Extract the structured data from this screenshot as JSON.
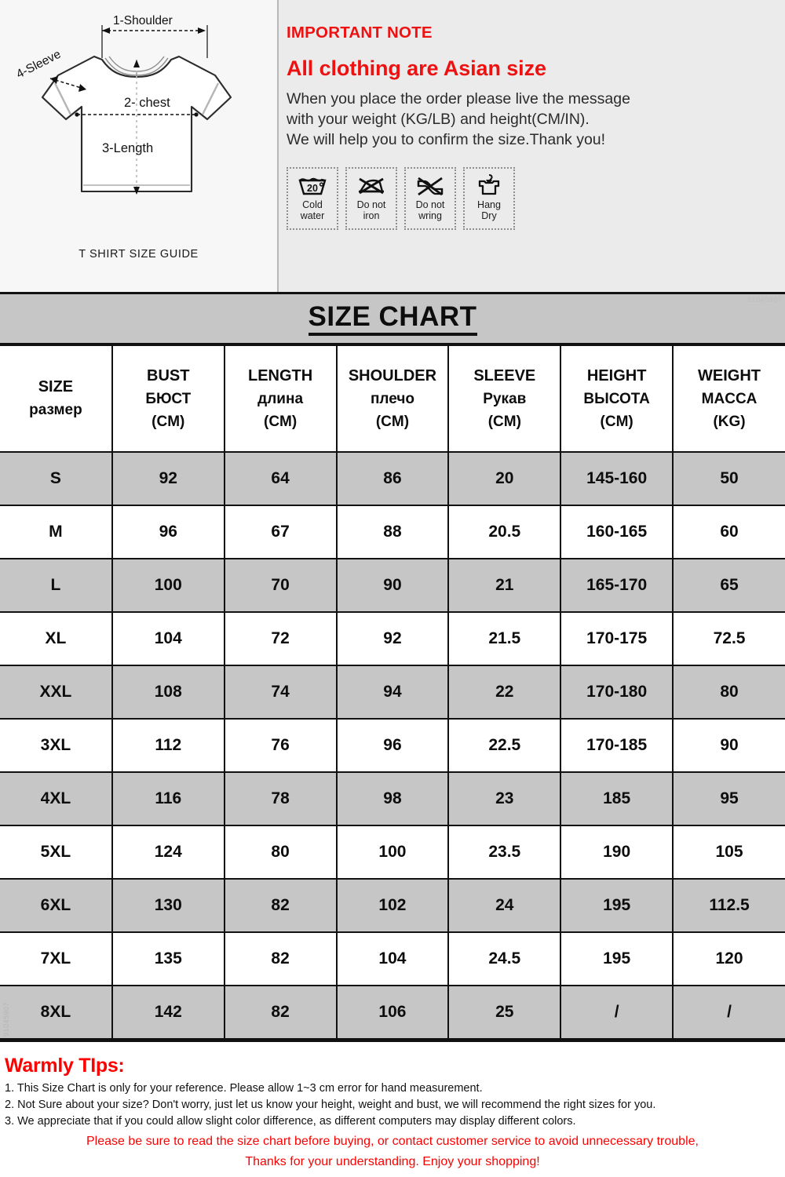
{
  "diagram": {
    "caption": "T SHIRT SIZE GUIDE",
    "labels": {
      "shoulder": "1-Shoulder",
      "sleeve": "4-Sleeve",
      "chest": "2- chest",
      "length": "3-Length"
    }
  },
  "note": {
    "title": "IMPORTANT NOTE",
    "headline": "All clothing are Asian size",
    "line1": "When you place the order please live the message",
    "line2": "with your weight (KG/LB) and height(CM/IN).",
    "line3": "We will help you to confirm the size.Thank you!"
  },
  "care_symbols": [
    {
      "icon": "cold-water-icon",
      "temp": "20",
      "label_line1": "Cold",
      "label_line2": "water"
    },
    {
      "icon": "do-not-iron-icon",
      "label_line1": "Do not",
      "label_line2": "iron"
    },
    {
      "icon": "do-not-wring-icon",
      "label_line1": "Do not",
      "label_line2": "wring"
    },
    {
      "icon": "hang-dry-icon",
      "label_line1": "Hang",
      "label_line2": "Dry"
    }
  ],
  "table": {
    "title": "SIZE CHART",
    "watermark": "91045907",
    "watermark_side": "91045907",
    "headers": [
      {
        "en": "SIZE",
        "ru": "размер",
        "unit": ""
      },
      {
        "en": "BUST",
        "ru": "БЮСТ",
        "unit": "(CM)"
      },
      {
        "en": "LENGTH",
        "ru": "длина",
        "unit": "(CM)"
      },
      {
        "en": "SHOULDER",
        "ru": "плечо",
        "unit": "(CM)"
      },
      {
        "en": "SLEEVE",
        "ru": "Рукав",
        "unit": "(CM)"
      },
      {
        "en": "HEIGHT",
        "ru": "ВЫСОТА",
        "unit": "(CM)"
      },
      {
        "en": "WEIGHT",
        "ru": "MACCA",
        "unit": "(KG)"
      }
    ],
    "rows": [
      {
        "size": "S",
        "bust": "92",
        "length": "64",
        "shoulder": "86",
        "sleeve": "20",
        "height": "145-160",
        "weight": "50"
      },
      {
        "size": "M",
        "bust": "96",
        "length": "67",
        "shoulder": "88",
        "sleeve": "20.5",
        "height": "160-165",
        "weight": "60"
      },
      {
        "size": "L",
        "bust": "100",
        "length": "70",
        "shoulder": "90",
        "sleeve": "21",
        "height": "165-170",
        "weight": "65"
      },
      {
        "size": "XL",
        "bust": "104",
        "length": "72",
        "shoulder": "92",
        "sleeve": "21.5",
        "height": "170-175",
        "weight": "72.5"
      },
      {
        "size": "XXL",
        "bust": "108",
        "length": "74",
        "shoulder": "94",
        "sleeve": "22",
        "height": "170-180",
        "weight": "80"
      },
      {
        "size": "3XL",
        "bust": "112",
        "length": "76",
        "shoulder": "96",
        "sleeve": "22.5",
        "height": "170-185",
        "weight": "90"
      },
      {
        "size": "4XL",
        "bust": "116",
        "length": "78",
        "shoulder": "98",
        "sleeve": "23",
        "height": "185",
        "weight": "95"
      },
      {
        "size": "5XL",
        "bust": "124",
        "length": "80",
        "shoulder": "100",
        "sleeve": "23.5",
        "height": "190",
        "weight": "105"
      },
      {
        "size": "6XL",
        "bust": "130",
        "length": "82",
        "shoulder": "102",
        "sleeve": "24",
        "height": "195",
        "weight": "112.5"
      },
      {
        "size": "7XL",
        "bust": "135",
        "length": "82",
        "shoulder": "104",
        "sleeve": "24.5",
        "height": "195",
        "weight": "120"
      },
      {
        "size": "8XL",
        "bust": "142",
        "length": "82",
        "shoulder": "106",
        "sleeve": "25",
        "height": "/",
        "weight": "/"
      }
    ]
  },
  "tips": {
    "title": "Warmly TIps:",
    "items": [
      "1. This Size Chart is only for your reference. Please allow 1~3 cm error for hand measurement.",
      "2. Not Sure about your size? Don't worry, just let us know your height, weight and bust, we will recommend the right sizes for you.",
      "3. We appreciate that if you could allow slight color difference, as different computers may display different colors."
    ],
    "red_line1": "Please be sure to read the size chart before buying, or contact customer service to avoid unnecessary trouble,",
    "red_line2": "Thanks for your understanding. Enjoy your shopping!"
  },
  "colors": {
    "accent_red": "#ee1111",
    "tips_red": "#ff0000",
    "row_gray": "#c6c6c6",
    "panel_gray": "#ebebeb"
  }
}
